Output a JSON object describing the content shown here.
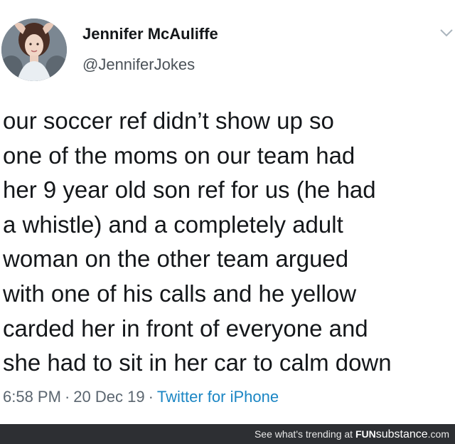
{
  "tweet": {
    "author_name": "Jennifer McAuliffe",
    "author_handle": "@JenniferJokes",
    "text_lines": [
      "our soccer ref didn’t show up so",
      "one of the moms on our team had",
      "her 9 year old son ref for us (he had",
      "a whistle) and a completely adult",
      "woman on the other team argued",
      "with one of his calls and he yellow",
      "carded her in front of everyone and",
      "she had to sit in her car to calm down"
    ],
    "time": "6:58 PM",
    "date": "20 Dec 19",
    "separator": "·",
    "source": "Twitter for iPhone",
    "menu_icon": "chevron-down-icon",
    "avatar_icon": "avatar"
  },
  "footer": {
    "prefix": "See what's trending at ",
    "brand_part1": "FUN",
    "brand_part2": "substance",
    "brand_part3": ".com"
  },
  "colors": {
    "text": "#14171a",
    "meta": "#5b6670",
    "link": "#1b86c4",
    "footer_bg": "#2d2f33"
  }
}
